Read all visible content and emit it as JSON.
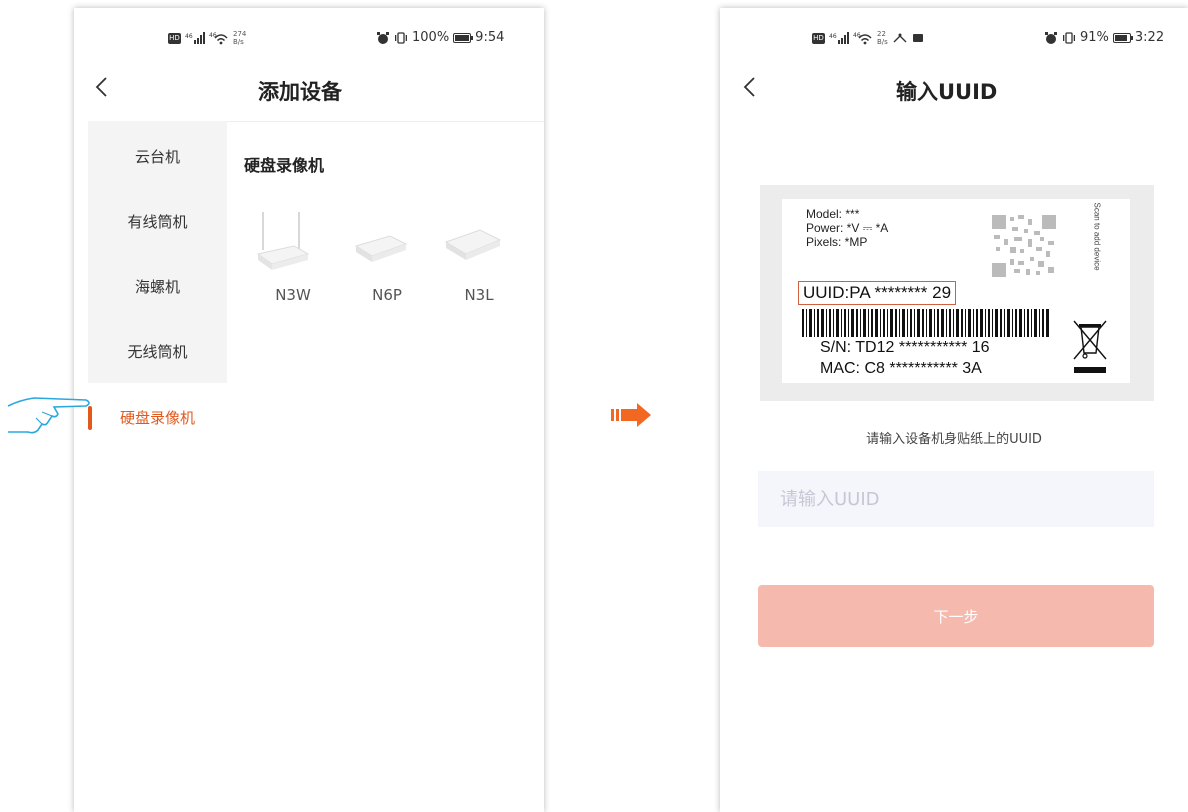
{
  "left_screen": {
    "status": {
      "speed_top": "274",
      "speed_bottom": "B/s",
      "battery": "100%",
      "time": "9:54"
    },
    "title": "添加设备",
    "categories": [
      "云台机",
      "有线筒机",
      "海螺机",
      "无线筒机",
      "硬盘录像机"
    ],
    "active_category": "硬盘录像机",
    "section_title": "硬盘录像机",
    "devices": [
      {
        "label": "N3W",
        "icon": "router-icon"
      },
      {
        "label": "N6P",
        "icon": "nvr-box-icon"
      },
      {
        "label": "N3L",
        "icon": "nvr-box-icon"
      }
    ],
    "active_color": "#e2591c"
  },
  "right_screen": {
    "status": {
      "speed_top": "22",
      "speed_bottom": "B/s",
      "battery": "91%",
      "time": "3:22"
    },
    "title": "输入UUID",
    "label_card": {
      "model": "Model: ***",
      "power": "Power: *V ⎓ *A",
      "pixels": "Pixels: *MP",
      "uuid": "UUID:PA ******** 29",
      "sn": "S/N: TD12 *********** 16",
      "mac": "MAC: C8 *********** 3A",
      "scan_text": "Scan to add device"
    },
    "hint": "请输入设备机身贴纸上的UUID",
    "input_placeholder": "请输入UUID",
    "next_button": "下一步",
    "button_color": "#f5b9ad"
  },
  "arrow_color": "#f26722"
}
